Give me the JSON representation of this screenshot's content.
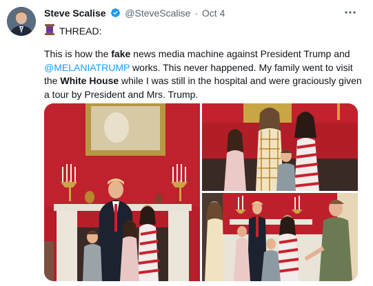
{
  "author": {
    "name": "Steve Scalise",
    "handle": "@SteveScalise",
    "separator": "·",
    "date": "Oct 4"
  },
  "thread_label": "THREAD:",
  "body": {
    "p1_before_fake": "This is how the ",
    "p1_fake": "fake",
    "p1_after_fake": " news media machine against President Trump and ",
    "mention": "@MELANIATRUMP",
    "p1_after_mention": " works. This never happened. My family went to visit the ",
    "white_house": "White House",
    "p1_end": " while I was still in the hospital and were graciously given a tour by President and Mrs. Trump."
  },
  "icons": {
    "verified": "verified-badge-icon",
    "more": "more-options-icon",
    "spool": "thread-spool-icon"
  },
  "colors": {
    "link": "#1d9bf0",
    "verified": "#1d9bf0",
    "secondary_text": "#536471",
    "red_room_wall": "#b81d2a"
  }
}
